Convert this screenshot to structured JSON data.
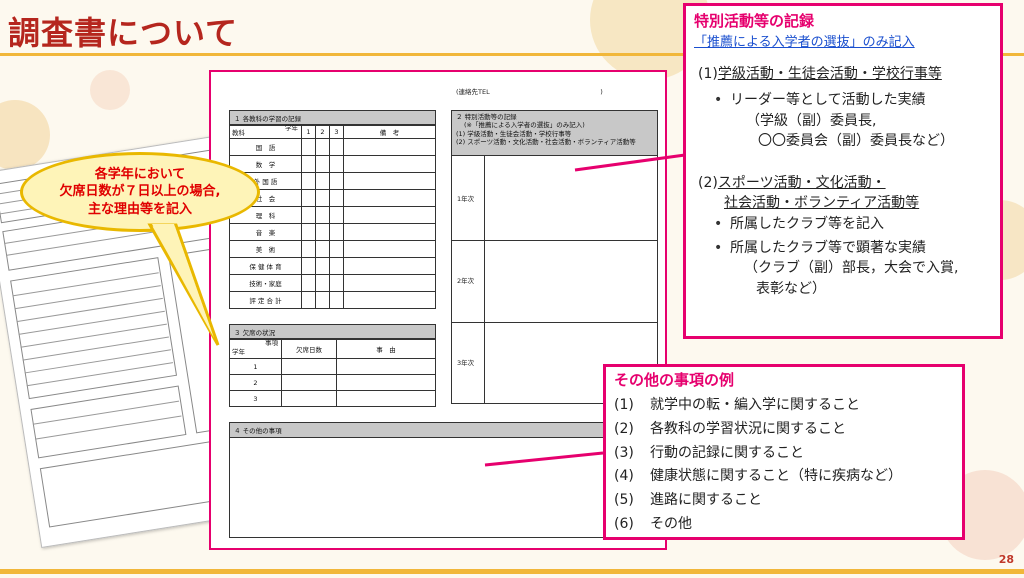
{
  "title": "調査書について",
  "page_number": "28",
  "colors": {
    "title": "#b5261e",
    "accent_pink": "#e6006e",
    "accent_gold": "#f1b73a",
    "callout_fill": "#fef4b8",
    "callout_text": "#e00000",
    "link": "#1a4fcf"
  },
  "callout": {
    "line1": "各学年において",
    "line2": "欠席日数が７日以上の場合,",
    "line3": "主な理由等を記入"
  },
  "form": {
    "contact_tel": "(連絡先TEL　　　　　　　　　　　　　　　　　)",
    "sec1_title": "１ 各教科の学習の記録",
    "sec1_col_subject": "教科",
    "sec1_col_grade": "学年",
    "g1": "1",
    "g2": "2",
    "g3": "3",
    "sec1_col_note": "備　考",
    "subjects": [
      "国　語",
      "数　学",
      "外 国 語",
      "社　会",
      "理　科",
      "音　楽",
      "美　術",
      "保 健 体 育",
      "技術・家庭",
      "評 定 合 計"
    ],
    "sec3_title": "３ 欠席の状況",
    "sec3_col_grade": "学年",
    "sec3_col_item": "事項",
    "sec3_col_days": "欠席日数",
    "sec3_col_reason": "事　由",
    "years": [
      "1",
      "2",
      "3"
    ],
    "sec2_title": "２ 特別活動等の記録",
    "sec2_note": "(※「推薦による入学者の選抜」のみ記入)",
    "sec2_line1": "(1) 学級活動・生徒会活動・学校行事等",
    "sec2_line2": "(2) スポーツ活動・文化活動・社会活動・ボランティア活動等",
    "sec2_years": [
      "1年次",
      "2年次",
      "3年次"
    ],
    "sec4_title": "４ その他の事項"
  },
  "special": {
    "title": "特別活動等の記録",
    "link": "「推薦による入学者の選抜」のみ記入",
    "item1_num": "(1)",
    "item1_text": "学級活動・生徒会活動・学校行事等",
    "item1_bullet": "リーダー等として活動した実績",
    "item1_sub1": "（学級（副）委員長,",
    "item1_sub2": "〇〇委員会（副）委員長など）",
    "item2_num": "(2)",
    "item2_text": "スポーツ活動・文化活動・",
    "item2_text2": "社会活動・ボランティア活動等",
    "item2_bullet1": "所属したクラブ等を記入",
    "item2_bullet2": "所属したクラブ等で顕著な実績",
    "item2_sub1": "（クラブ（副）部長，大会で入賞,",
    "item2_sub2": "表彰など）"
  },
  "other": {
    "title": "その他の事項の例",
    "items": [
      {
        "num": "(1)",
        "text": "就学中の転・編入学に関すること"
      },
      {
        "num": "(2)",
        "text": "各教科の学習状況に関すること"
      },
      {
        "num": "(3)",
        "text": "行動の記録に関すること"
      },
      {
        "num": "(4)",
        "text": "健康状態に関すること（特に疾病など）"
      },
      {
        "num": "(5)",
        "text": "進路に関すること"
      },
      {
        "num": "(6)",
        "text": "その他"
      }
    ]
  }
}
